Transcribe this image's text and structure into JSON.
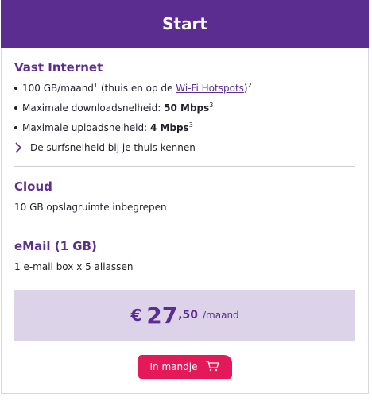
{
  "header": {
    "title": "Start"
  },
  "internet": {
    "title": "Vast Internet",
    "bullet1_text": "100 GB/maand",
    "bullet1_sup1": "1",
    "bullet1_middle": " (thuis en op de ",
    "bullet1_link": "Wi-Fi Hotspots",
    "bullet1_end": ")",
    "bullet1_sup2": "2",
    "bullet2_text": "Maximale downloadsnelheid: ",
    "bullet2_value": "50 Mbps",
    "bullet2_sup": "3",
    "bullet3_text": "Maximale uploadsnelheid: ",
    "bullet3_value": "4 Mbps",
    "bullet3_sup": "3",
    "speed_link": "De surfsnelheid bij je thuis kennen"
  },
  "cloud": {
    "title": "Cloud",
    "text": "10 GB opslagruimte inbegrepen"
  },
  "email": {
    "title": "eMail (1 GB)",
    "text": "1 e-mail box x 5 aliassen"
  },
  "price": {
    "currency": "€",
    "integer": "27",
    "decimal": ",50",
    "unit": "/maand"
  },
  "cart": {
    "label": "In mandje",
    "icon": "cart-icon"
  },
  "colors": {
    "brand": "#5c2d91",
    "price_bg": "#ddd3e9",
    "cta": "#e5195a"
  }
}
